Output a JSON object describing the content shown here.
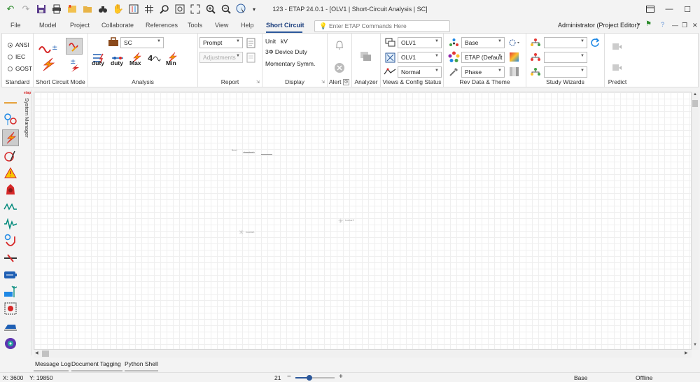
{
  "window": {
    "title": "123 - ETAP 24.0.1 - [OLV1 | Short-Circuit Analysis | SC]"
  },
  "menu": {
    "items": [
      "File",
      "Model",
      "Project",
      "Collaborate",
      "References",
      "Tools",
      "View",
      "Help",
      "Short Circuit"
    ],
    "active": "Short Circuit",
    "search_placeholder": "Enter ETAP Commands Here",
    "user": "Administrator (Project Editor)"
  },
  "ribbon": {
    "standard": {
      "label": "Standard",
      "options": [
        "ANSI",
        "IEC",
        "GOST"
      ],
      "selected": "ANSI"
    },
    "sc_mode": {
      "label": "Short Circuit Mode"
    },
    "analysis": {
      "label": "Analysis",
      "study_case": "SC",
      "buttons": [
        "duty",
        "duty",
        "Max",
        "Min"
      ]
    },
    "report": {
      "label": "Report",
      "output": "Prompt",
      "adjustments": "Adjustments"
    },
    "display": {
      "label": "Display",
      "unit_label": "Unit",
      "unit_value": "kV",
      "device_duty": "3Φ Device Duty",
      "momentary": "Momentary Symm."
    },
    "alert": {
      "label": "Alert"
    },
    "analyzer": {
      "label": "Analyzer"
    },
    "views": {
      "label": "Views & Config Status",
      "view1": "OLV1",
      "view2": "OLV1",
      "config": "Normal"
    },
    "rev_data": {
      "label": "Rev Data & Theme",
      "revision": "Base",
      "theme": "ETAP (Default",
      "phase": "Phase"
    },
    "wizards": {
      "label": "Study Wizards"
    },
    "predict": {
      "label": "Predict"
    }
  },
  "side_panel": {
    "label": "System Manager"
  },
  "canvas_labels": {
    "bus1": "Bus1",
    "breaker": "breaker1",
    "busbar1": "busbar1",
    "busbar2": "busbar2"
  },
  "bottom_tabs": [
    "Message Log",
    "Document Tagging",
    "Python Shell"
  ],
  "status": {
    "x": "X: 3600",
    "y": "Y: 19850",
    "zoom": "21",
    "revision": "Base",
    "connection": "Offline"
  },
  "colors": {
    "accent": "#2b579a",
    "toolbar_red": "#d62828",
    "toolbar_orange": "#f0a000"
  }
}
